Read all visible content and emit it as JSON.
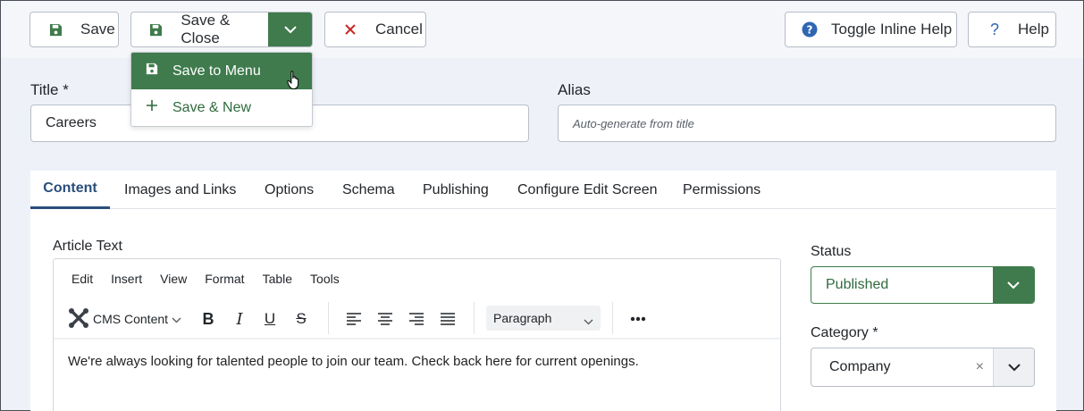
{
  "toolbar": {
    "save_label": "Save",
    "save_close_label": "Save & Close",
    "cancel_label": "Cancel",
    "toggle_help_label": "Toggle Inline Help",
    "help_label": "Help"
  },
  "save_dropdown": {
    "items": [
      {
        "label": "Save to Menu",
        "icon": "floppy-disk-icon",
        "active": true
      },
      {
        "label": "Save & New",
        "icon": "plus-icon",
        "active": false
      }
    ]
  },
  "form": {
    "title_label": "Title *",
    "title_value": "Careers",
    "alias_label": "Alias",
    "alias_placeholder": "Auto-generate from title"
  },
  "tabs": [
    {
      "label": "Content",
      "active": true
    },
    {
      "label": "Images and Links",
      "active": false
    },
    {
      "label": "Options",
      "active": false
    },
    {
      "label": "Schema",
      "active": false
    },
    {
      "label": "Publishing",
      "active": false
    },
    {
      "label": "Configure Edit Screen",
      "active": false
    },
    {
      "label": "Permissions",
      "active": false
    }
  ],
  "editor": {
    "label": "Article Text",
    "menu": [
      "Edit",
      "Insert",
      "View",
      "Format",
      "Table",
      "Tools"
    ],
    "cms_content_label": "CMS Content",
    "block_format": "Paragraph",
    "body_text": "We're always looking for talented people to join our team. Check back here for current openings."
  },
  "sidebar": {
    "status_label": "Status",
    "status_value": "Published",
    "category_label": "Category *",
    "category_value": "Company",
    "clear_symbol": "×"
  },
  "colors": {
    "accent_green": "#3f7b4c",
    "tab_active": "#2a4e7b",
    "cancel_red": "#c52827",
    "help_blue": "#2f66b3"
  }
}
